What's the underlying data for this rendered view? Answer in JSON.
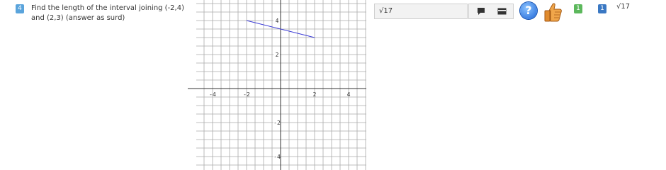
{
  "question": {
    "number": "4",
    "text": "Find the length of the interval joining (-2,4) and (2,3) (answer as surd)"
  },
  "answer": {
    "value": "√17"
  },
  "status": {
    "green_badge": "1",
    "blue_badge": "1",
    "previous_answer": "√17"
  },
  "icons": {
    "help": "?",
    "comment": "comment-icon",
    "card": "card-icon",
    "thumb": "thumbs-up-icon",
    "help_name": "help-icon"
  },
  "graph": {
    "x_ticks": [
      "-4",
      "-2",
      "2",
      "4"
    ],
    "y_ticks": [
      "4",
      "2",
      "-2",
      "-4"
    ],
    "segment": {
      "from": [
        -2,
        4
      ],
      "to": [
        2,
        3
      ]
    },
    "line_color": "#3a3ad6"
  }
}
